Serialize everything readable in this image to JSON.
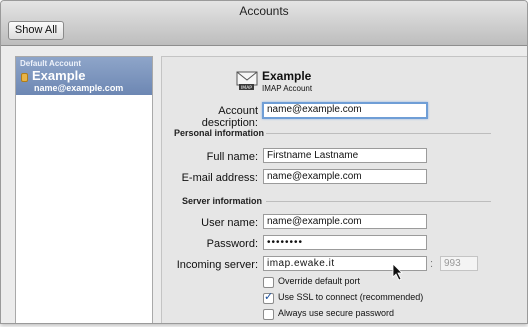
{
  "window": {
    "title": "Accounts"
  },
  "toolbar": {
    "show_all_label": "Show All"
  },
  "sidebar": {
    "section_label": "Default Account",
    "account_name": "Example",
    "account_email": "name@example.com"
  },
  "header": {
    "account_name": "Example",
    "account_type": "IMAP Account",
    "icon": "mail-envelope-icon"
  },
  "form": {
    "account_description_label": "Account description:",
    "account_description_value": "name@example.com",
    "personal_section": "Personal information",
    "full_name_label": "Full name:",
    "full_name_value": "Firstname Lastname",
    "email_label": "E-mail address:",
    "email_value": "name@example.com",
    "server_section": "Server information",
    "username_label": "User name:",
    "username_value": "name@example.com",
    "password_label": "Password:",
    "password_value": "••••••••",
    "incoming_label": "Incoming server:",
    "incoming_value": "imap.ewake.it",
    "port_separator": ":",
    "port_placeholder": "993",
    "override_port_label": "Override default port",
    "override_port_checked": false,
    "ssl_label": "Use SSL to connect (recommended)",
    "ssl_checked": true,
    "secure_password_label": "Always use secure password",
    "secure_password_checked": false
  },
  "colors": {
    "selection": "#7892bd",
    "focus_ring": "#6f9ed6"
  }
}
